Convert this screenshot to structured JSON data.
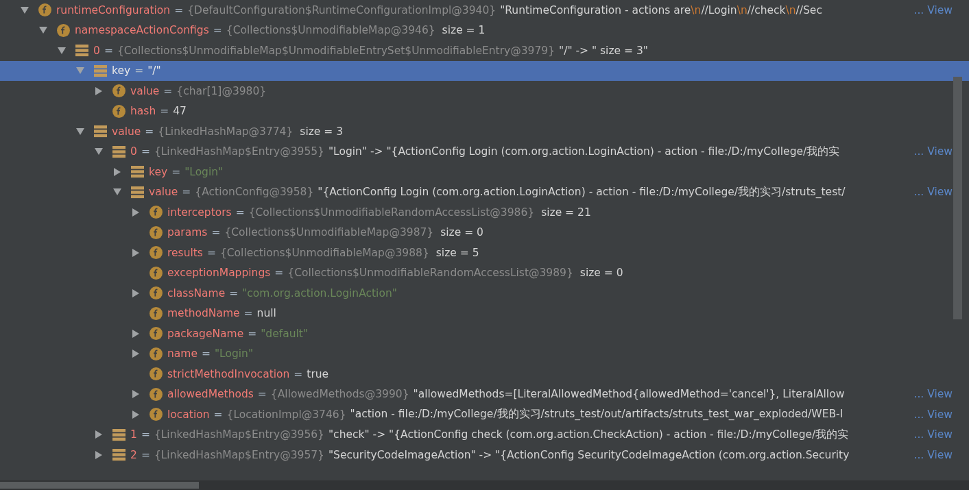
{
  "variables": [
    {
      "kind": "field",
      "expanded": true,
      "selected": false,
      "name": "runtimeConfiguration",
      "eq": "=",
      "type": "{DefaultConfiguration$RuntimeConfigurationImpl@3940}",
      "summary": [
        {
          "kind": "plain",
          "text": "\"RuntimeConfiguration - actions are"
        },
        {
          "kind": "escape",
          "text": "\\n"
        },
        {
          "kind": "plain",
          "text": "//Login"
        },
        {
          "kind": "escape",
          "text": "\\n"
        },
        {
          "kind": "plain",
          "text": "//check"
        },
        {
          "kind": "escape",
          "text": "\\n"
        },
        {
          "kind": "plain",
          "text": "//Sec"
        }
      ],
      "view": "... View",
      "children": [
        {
          "kind": "field",
          "expanded": true,
          "selected": false,
          "name": "namespaceActionConfigs",
          "eq": "=",
          "type": "{Collections$UnmodifiableMap@3946}",
          "size": "size = 1",
          "children": [
            {
              "kind": "entry",
              "expanded": true,
              "selected": false,
              "name": "0",
              "eq": "=",
              "type": "{Collections$UnmodifiableMap$UnmodifiableEntrySet$UnmodifiableEntry@3979}",
              "summary": [
                {
                  "kind": "plain",
                  "text": "\"/\" -> \" size = 3\""
                }
              ],
              "children": [
                {
                  "kind": "entry",
                  "expanded": true,
                  "selected": true,
                  "name": "key",
                  "eq": "=",
                  "value": {
                    "kind": "string",
                    "text": "\"/\""
                  },
                  "children": [
                    {
                      "kind": "field",
                      "expanded": false,
                      "selected": false,
                      "name": "value",
                      "eq": "=",
                      "type": "{char[1]@3980}"
                    },
                    {
                      "kind": "field",
                      "selected": false,
                      "name": "hash",
                      "eq": "=",
                      "value": {
                        "kind": "literal",
                        "text": "47"
                      }
                    }
                  ]
                },
                {
                  "kind": "entry",
                  "expanded": true,
                  "selected": false,
                  "name": "value",
                  "eq": "=",
                  "type": "{LinkedHashMap@3774}",
                  "size": "size = 3",
                  "children": [
                    {
                      "kind": "entry",
                      "expanded": true,
                      "selected": false,
                      "name": "0",
                      "eq": "=",
                      "type": "{LinkedHashMap$Entry@3955}",
                      "summary": [
                        {
                          "kind": "plain",
                          "text": "\"Login\" -> \"{ActionConfig Login (com.org.action.LoginAction) - action - file:/D:/myCollege/我的实"
                        }
                      ],
                      "view": "... View",
                      "children": [
                        {
                          "kind": "entry",
                          "expanded": false,
                          "selected": false,
                          "name": "key",
                          "eq": "=",
                          "value": {
                            "kind": "string",
                            "text": "\"Login\""
                          }
                        },
                        {
                          "kind": "entry",
                          "expanded": true,
                          "selected": false,
                          "name": "value",
                          "eq": "=",
                          "type": "{ActionConfig@3958}",
                          "summary": [
                            {
                              "kind": "plain",
                              "text": "\"{ActionConfig Login (com.org.action.LoginAction) - action - file:/D:/myCollege/我的实习/struts_test/"
                            }
                          ],
                          "view": "... View",
                          "children": [
                            {
                              "kind": "field",
                              "expanded": false,
                              "selected": false,
                              "name": "interceptors",
                              "eq": "=",
                              "type": "{Collections$UnmodifiableRandomAccessList@3986}",
                              "size": "size = 21"
                            },
                            {
                              "kind": "field",
                              "selected": false,
                              "name": "params",
                              "eq": "=",
                              "type": "{Collections$UnmodifiableMap@3987}",
                              "size": "size = 0"
                            },
                            {
                              "kind": "field",
                              "expanded": false,
                              "selected": false,
                              "name": "results",
                              "eq": "=",
                              "type": "{Collections$UnmodifiableMap@3988}",
                              "size": "size = 5"
                            },
                            {
                              "kind": "field",
                              "selected": false,
                              "name": "exceptionMappings",
                              "eq": "=",
                              "type": "{Collections$UnmodifiableRandomAccessList@3989}",
                              "size": "size = 0"
                            },
                            {
                              "kind": "field",
                              "expanded": false,
                              "selected": false,
                              "name": "className",
                              "eq": "=",
                              "value": {
                                "kind": "string",
                                "text": "\"com.org.action.LoginAction\""
                              }
                            },
                            {
                              "kind": "field",
                              "selected": false,
                              "name": "methodName",
                              "eq": "=",
                              "value": {
                                "kind": "literal",
                                "text": "null"
                              }
                            },
                            {
                              "kind": "field",
                              "expanded": false,
                              "selected": false,
                              "name": "packageName",
                              "eq": "=",
                              "value": {
                                "kind": "string",
                                "text": "\"default\""
                              }
                            },
                            {
                              "kind": "field",
                              "expanded": false,
                              "selected": false,
                              "name": "name",
                              "eq": "=",
                              "value": {
                                "kind": "string",
                                "text": "\"Login\""
                              }
                            },
                            {
                              "kind": "field",
                              "selected": false,
                              "name": "strictMethodInvocation",
                              "eq": "=",
                              "value": {
                                "kind": "literal",
                                "text": "true"
                              }
                            },
                            {
                              "kind": "field",
                              "expanded": false,
                              "selected": false,
                              "name": "allowedMethods",
                              "eq": "=",
                              "type": "{AllowedMethods@3990}",
                              "summary": [
                                {
                                  "kind": "plain",
                                  "text": "\"allowedMethods=[LiteralAllowedMethod{allowedMethod='cancel'}, LiteralAllow"
                                }
                              ],
                              "view": "... View"
                            },
                            {
                              "kind": "field",
                              "expanded": false,
                              "selected": false,
                              "name": "location",
                              "eq": "=",
                              "type": "{LocationImpl@3746}",
                              "summary": [
                                {
                                  "kind": "plain",
                                  "text": "\"action - file:/D:/myCollege/我的实习/struts_test/out/artifacts/struts_test_war_exploded/WEB-I"
                                }
                              ],
                              "view": "... View"
                            }
                          ]
                        }
                      ]
                    },
                    {
                      "kind": "entry",
                      "expanded": false,
                      "selected": false,
                      "name": "1",
                      "eq": "=",
                      "type": "{LinkedHashMap$Entry@3956}",
                      "summary": [
                        {
                          "kind": "plain",
                          "text": "\"check\" -> \"{ActionConfig check (com.org.action.CheckAction) - action - file:/D:/myCollege/我的实"
                        }
                      ],
                      "view": "... View"
                    },
                    {
                      "kind": "entry",
                      "expanded": false,
                      "selected": false,
                      "name": "2",
                      "eq": "=",
                      "type": "{LinkedHashMap$Entry@3957}",
                      "summary": [
                        {
                          "kind": "plain",
                          "text": "\"SecurityCodeImageAction\" -> \"{ActionConfig SecurityCodeImageAction (com.org.action.Security"
                        }
                      ],
                      "view": "... View"
                    }
                  ]
                }
              ]
            }
          ]
        }
      ]
    }
  ]
}
